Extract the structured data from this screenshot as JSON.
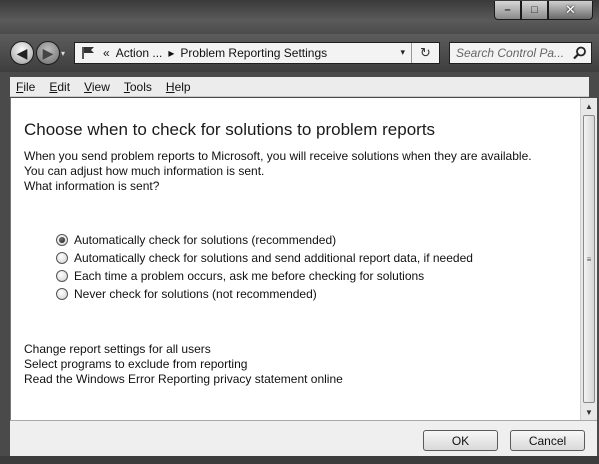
{
  "window": {
    "caption_buttons": {
      "minimize": "–",
      "maximize": "□",
      "close": "✕"
    }
  },
  "nav": {
    "back_glyph": "◀",
    "forward_glyph": "▶",
    "history_glyph": "▾",
    "address": {
      "prefix": "«",
      "crumbs": [
        "Action ...",
        "Problem Reporting Settings"
      ],
      "separator": "▸",
      "dropdown_glyph": "▾",
      "refresh_glyph": "↻"
    },
    "search": {
      "placeholder": "Search Control Pa..."
    }
  },
  "menu": {
    "items": [
      {
        "label": "File",
        "accel": "F"
      },
      {
        "label": "Edit",
        "accel": "E"
      },
      {
        "label": "View",
        "accel": "V"
      },
      {
        "label": "Tools",
        "accel": "T"
      },
      {
        "label": "Help",
        "accel": "H"
      }
    ]
  },
  "content": {
    "heading": "Choose when to check for solutions to problem reports",
    "desc_line1": "When you send problem reports to Microsoft, you will receive solutions when they are available.",
    "desc_line2": "You can adjust how much information is sent.",
    "what_info_link": "What information is sent?",
    "options": [
      {
        "label": "Automatically check for solutions (recommended)",
        "checked": true
      },
      {
        "label": "Automatically check for solutions and send additional report data, if needed",
        "checked": false
      },
      {
        "label": "Each time a problem occurs, ask me before checking for solutions",
        "checked": false
      },
      {
        "label": "Never check for solutions (not recommended)",
        "checked": false
      }
    ],
    "links": [
      "Change report settings for all users",
      "Select programs to exclude from reporting",
      "Read the Windows Error Reporting privacy statement online"
    ]
  },
  "scrollbar": {
    "up": "▲",
    "down": "▼",
    "grip": "≡"
  },
  "buttons": {
    "ok": "OK",
    "cancel": "Cancel"
  }
}
